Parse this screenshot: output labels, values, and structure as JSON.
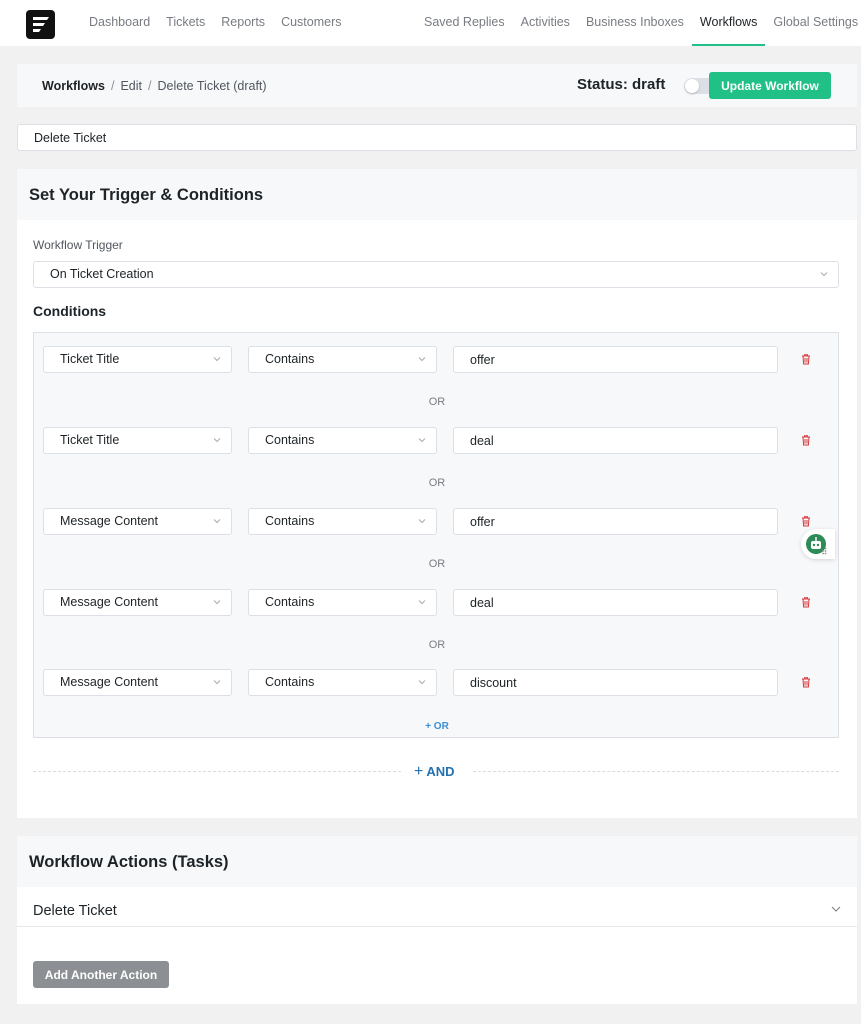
{
  "nav": {
    "left": [
      "Dashboard",
      "Tickets",
      "Reports",
      "Customers"
    ],
    "right": [
      "Saved Replies",
      "Activities",
      "Business Inboxes",
      "Workflows",
      "Global Settings"
    ],
    "active": "Workflows"
  },
  "header": {
    "breadcrumb": [
      "Workflows",
      "Edit",
      "Delete Ticket (draft)"
    ],
    "status_label": "Status: draft",
    "update_button": "Update Workflow"
  },
  "workflow_title": "Delete Ticket",
  "trigger_section": {
    "title": "Set Your Trigger & Conditions",
    "trigger_label": "Workflow Trigger",
    "trigger_value": "On Ticket Creation",
    "conditions_title": "Conditions",
    "conditions": [
      {
        "field": "Ticket Title",
        "operator": "Contains",
        "value": "offer"
      },
      {
        "field": "Ticket Title",
        "operator": "Contains",
        "value": "deal"
      },
      {
        "field": "Message Content",
        "operator": "Contains",
        "value": "offer"
      },
      {
        "field": "Message Content",
        "operator": "Contains",
        "value": "deal"
      },
      {
        "field": "Message Content",
        "operator": "Contains",
        "value": "discount"
      }
    ],
    "or_label": "OR",
    "add_or": "+ OR",
    "add_and": "AND"
  },
  "actions_section": {
    "title": "Workflow Actions (Tasks)",
    "actions": [
      "Delete Ticket"
    ],
    "add_button": "Add Another Action"
  },
  "colors": {
    "accent": "#20c087",
    "link": "#2271b1",
    "trash": "#d63638"
  }
}
